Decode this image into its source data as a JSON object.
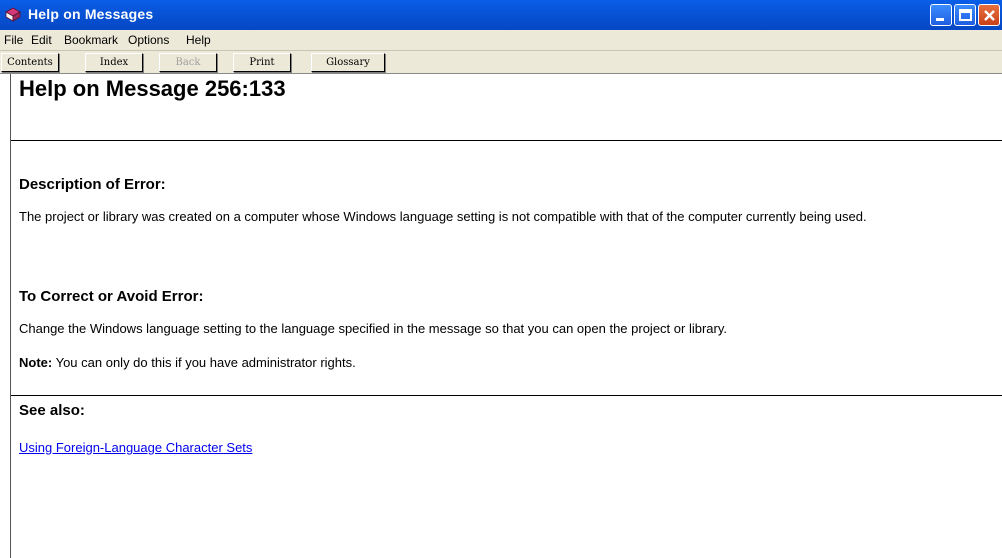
{
  "window": {
    "title": "Help on Messages",
    "controls": [
      "minimize",
      "maximize",
      "close"
    ]
  },
  "menubar": {
    "items": [
      "File",
      "Edit",
      "Bookmark",
      "Options",
      "Help"
    ]
  },
  "toolbar": {
    "buttons": [
      {
        "label": "Contents",
        "enabled": true
      },
      {
        "label": "Index",
        "enabled": true
      },
      {
        "label": "Back",
        "enabled": false
      },
      {
        "label": "Print",
        "enabled": true
      },
      {
        "label": "Glossary",
        "enabled": true
      }
    ]
  },
  "content": {
    "title": "Help on Message 256:133",
    "description_heading": "Description of Error:",
    "description_text": "The project or library was created on a computer whose Windows language setting is not compatible with that of the computer currently being used.",
    "correct_heading": "To Correct or Avoid Error:",
    "correct_text": "Change the Windows language setting to the language specified in the message so that you can open the project or library.",
    "note_label": "Note:",
    "note_text": " You can only do this if you have administrator rights.",
    "see_also_heading": "See also:",
    "see_also_link": "Using Foreign-Language Character Sets"
  },
  "colors": {
    "titlebar": "#0a5ee8",
    "chrome": "#ece9d8",
    "link": "#0000ee"
  },
  "icons": {
    "app": "help-book-icon"
  }
}
